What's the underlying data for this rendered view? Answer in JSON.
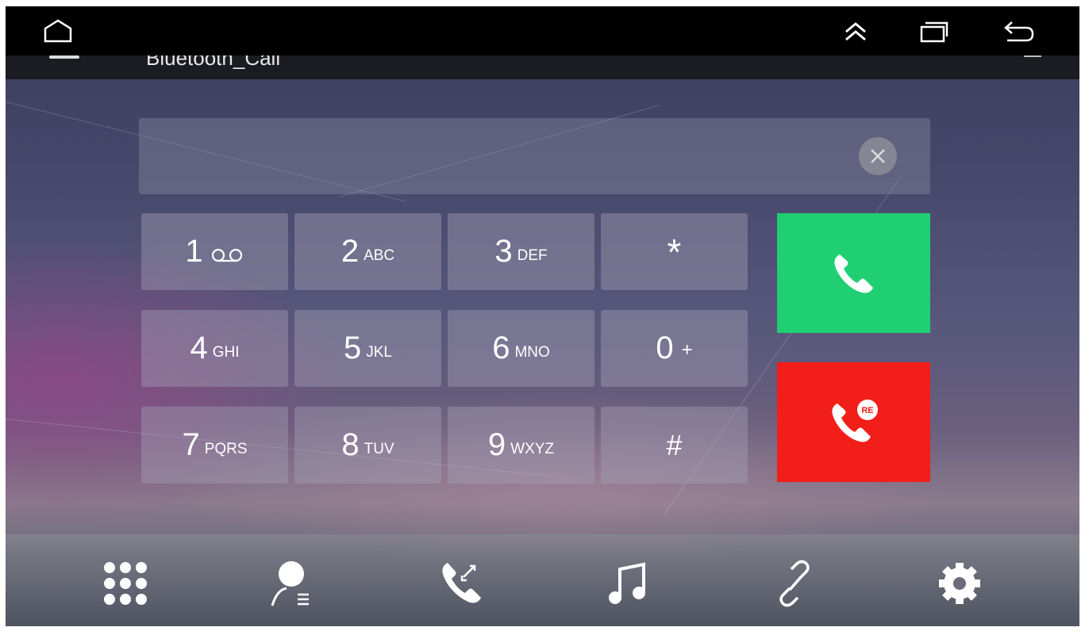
{
  "app": {
    "title": "Bluetooth_Call"
  },
  "statusbar": {
    "icons": [
      "home-icon",
      "chevron-up-double-icon",
      "recent-apps-icon",
      "back-icon"
    ]
  },
  "dialer": {
    "number_value": "",
    "keys": [
      {
        "digit": "1",
        "letters": ""
      },
      {
        "digit": "2",
        "letters": "ABC"
      },
      {
        "digit": "3",
        "letters": "DEF"
      },
      {
        "digit": "*",
        "letters": ""
      },
      {
        "digit": "4",
        "letters": "GHI"
      },
      {
        "digit": "5",
        "letters": "JKL"
      },
      {
        "digit": "6",
        "letters": "MNO"
      },
      {
        "digit": "0",
        "letters": "+"
      },
      {
        "digit": "7",
        "letters": "PQRS"
      },
      {
        "digit": "8",
        "letters": "TUV"
      },
      {
        "digit": "9",
        "letters": "WXYZ"
      },
      {
        "digit": "#",
        "letters": ""
      }
    ],
    "redial_badge": "RE",
    "colors": {
      "call": "#1fcf72",
      "end": "#f21e1a"
    }
  },
  "bottom_nav": {
    "items": [
      "dialpad-icon",
      "contacts-icon",
      "call-log-icon",
      "music-icon",
      "link-icon",
      "settings-icon"
    ]
  }
}
